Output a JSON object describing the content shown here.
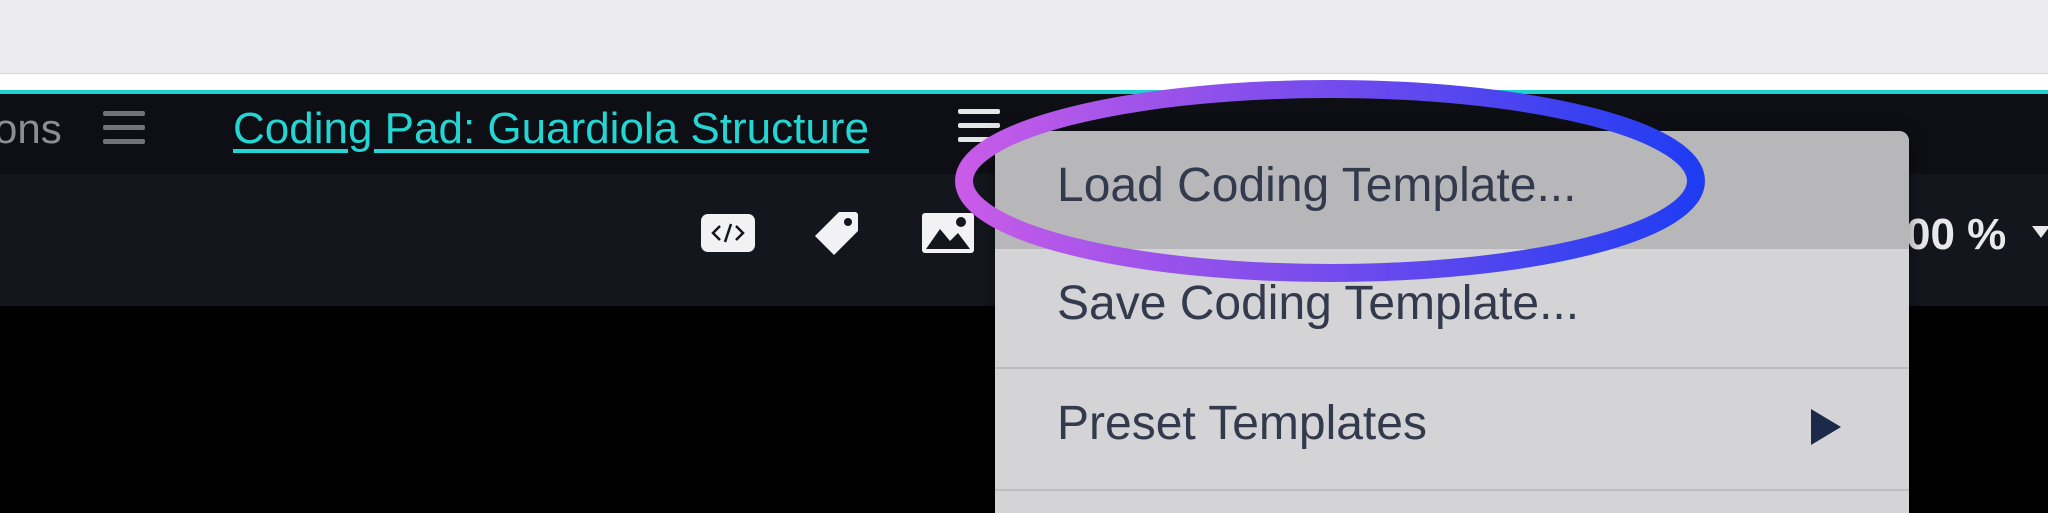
{
  "tabs": {
    "previous_tab_label": "ons",
    "active_tab_title": "Coding Pad: Guardiola Structure"
  },
  "toolbar": {
    "icons": [
      "code-icon",
      "tag-icon",
      "image-icon"
    ],
    "zoom_value": "00 %"
  },
  "context_menu": {
    "items": [
      {
        "label": "Load Coding Template..."
      },
      {
        "label": "Save Coding Template..."
      },
      {
        "label": "Preset Templates",
        "has_submenu": true
      }
    ]
  },
  "colors": {
    "accent": "#1fd2cf",
    "menu_background": "#d4d4d6",
    "menu_highlight": "#b7b7b9",
    "annotation_gradient_start": "#c85be8",
    "annotation_gradient_end": "#1f3cf2"
  }
}
